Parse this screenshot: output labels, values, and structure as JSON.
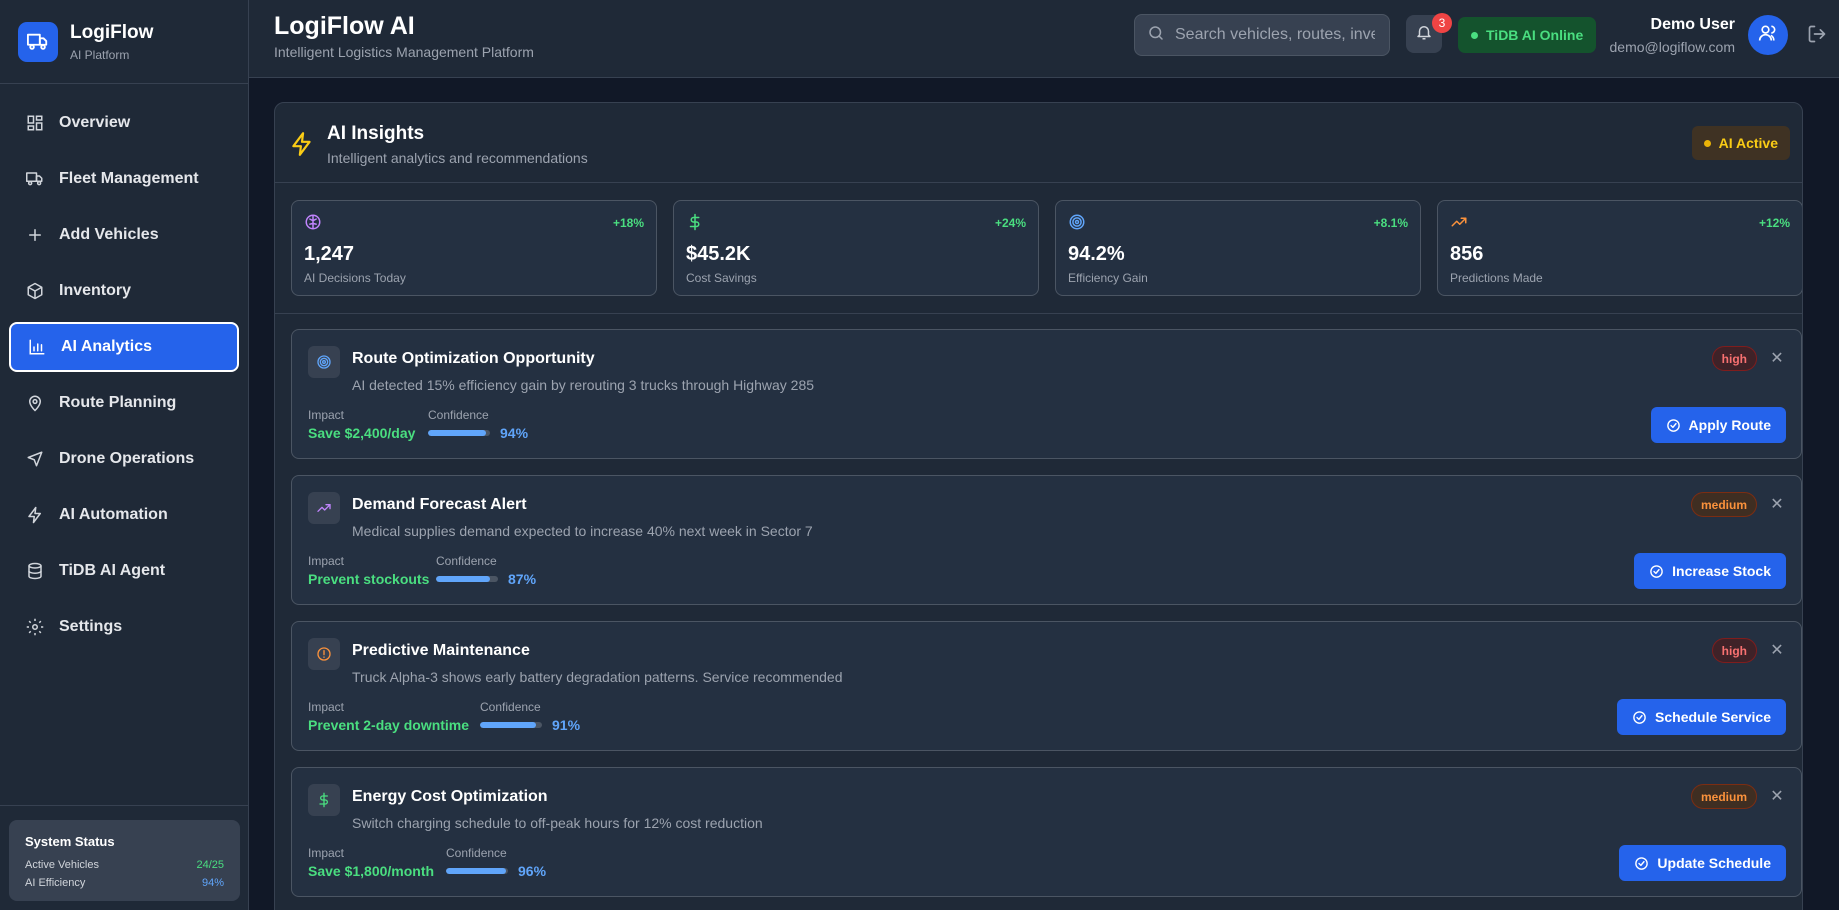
{
  "brand": {
    "name": "LogiFlow",
    "subtitle": "AI Platform",
    "icon": "truck-icon"
  },
  "nav": [
    {
      "label": "Overview",
      "icon": "grid-icon"
    },
    {
      "label": "Fleet Management",
      "icon": "truck-icon"
    },
    {
      "label": "Add Vehicles",
      "icon": "plus-icon"
    },
    {
      "label": "Inventory",
      "icon": "package-icon"
    },
    {
      "label": "AI Analytics",
      "icon": "bar-chart-icon",
      "active": true
    },
    {
      "label": "Route Planning",
      "icon": "map-pin-icon"
    },
    {
      "label": "Drone Operations",
      "icon": "plane-icon"
    },
    {
      "label": "AI Automation",
      "icon": "bolt-icon"
    },
    {
      "label": "TiDB AI Agent",
      "icon": "database-icon"
    },
    {
      "label": "Settings",
      "icon": "gear-icon"
    }
  ],
  "system_status": {
    "title": "System Status",
    "rows": [
      {
        "label": "Active Vehicles",
        "value": "24/25"
      },
      {
        "label": "AI Efficiency",
        "value": "94%"
      }
    ]
  },
  "header": {
    "title": "LogiFlow AI",
    "subtitle": "Intelligent Logistics Management Platform",
    "search_placeholder": "Search vehicles, routes, inventory...",
    "notification_count": "3",
    "tidb_status": "TiDB AI Online",
    "user_name": "Demo User",
    "user_email": "demo@logiflow.com"
  },
  "insights": {
    "title": "AI Insights",
    "subtitle": "Intelligent analytics and recommendations",
    "status": "AI Active",
    "stats": [
      {
        "icon": "brain-icon",
        "delta": "+18%",
        "value": "1,247",
        "label": "AI Decisions Today",
        "color": "#c084fc"
      },
      {
        "icon": "dollar-icon",
        "delta": "+24%",
        "value": "$45.2K",
        "label": "Cost Savings",
        "color": "#4ade80"
      },
      {
        "icon": "target-icon",
        "delta": "+8.1%",
        "value": "94.2%",
        "label": "Efficiency Gain",
        "color": "#60a5fa"
      },
      {
        "icon": "trending-up-icon",
        "delta": "+12%",
        "value": "856",
        "label": "Predictions Made",
        "color": "#fb923c"
      }
    ],
    "cards": [
      {
        "icon": "target-icon",
        "title": "Route Optimization Opportunity",
        "description": "AI detected 15% efficiency gain by rerouting 3 trucks through Highway 285",
        "priority": "high",
        "impact_label": "Impact",
        "impact": "Save $2,400/day",
        "confidence_label": "Confidence",
        "confidence": "94%",
        "confidence_value": 0.94,
        "action": "Apply Route"
      },
      {
        "icon": "trending-up-icon",
        "title": "Demand Forecast Alert",
        "description": "Medical supplies demand expected to increase 40% next week in Sector 7",
        "priority": "medium",
        "impact_label": "Impact",
        "impact": "Prevent stockouts",
        "confidence_label": "Confidence",
        "confidence": "87%",
        "confidence_value": 0.87,
        "action": "Increase Stock"
      },
      {
        "icon": "alert-circle-icon",
        "title": "Predictive Maintenance",
        "description": "Truck Alpha-3 shows early battery degradation patterns. Service recommended",
        "priority": "high",
        "impact_label": "Impact",
        "impact": "Prevent 2-day downtime",
        "confidence_label": "Confidence",
        "confidence": "91%",
        "confidence_value": 0.91,
        "action": "Schedule Service"
      },
      {
        "icon": "dollar-icon",
        "title": "Energy Cost Optimization",
        "description": "Switch charging schedule to off-peak hours for 12% cost reduction",
        "priority": "medium",
        "impact_label": "Impact",
        "impact": "Save $1,800/month",
        "confidence_label": "Confidence",
        "confidence": "96%",
        "confidence_value": 0.96,
        "action": "Update Schedule"
      }
    ]
  }
}
